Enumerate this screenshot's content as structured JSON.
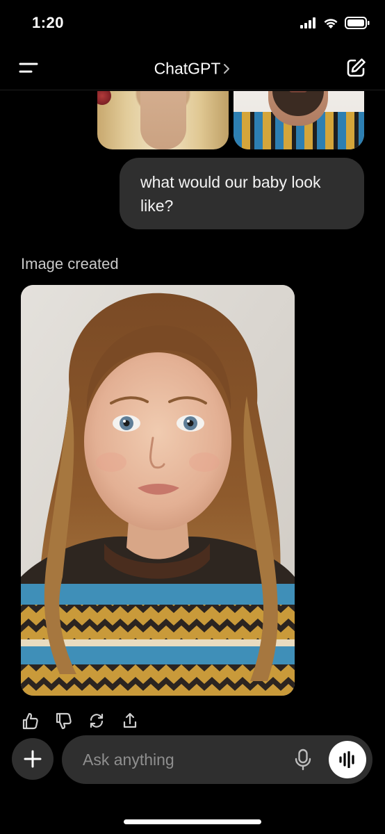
{
  "status_bar": {
    "time": "1:20",
    "icons": [
      "cellular-signal-icon",
      "wifi-icon",
      "battery-icon"
    ]
  },
  "nav": {
    "title": "ChatGPT",
    "icons": [
      "menu-icon",
      "chevron-right-icon",
      "new-chat-icon"
    ]
  },
  "chat": {
    "user_images": [
      "woman-portrait-photo",
      "man-portrait-photo"
    ],
    "user_message": "what would our baby look like?",
    "assistant_label": "Image created",
    "generated_image": "toddler-portrait-image",
    "actions": [
      "thumbs-up-icon",
      "thumbs-down-icon",
      "regenerate-icon",
      "share-icon"
    ]
  },
  "composer": {
    "placeholder": "Ask anything",
    "icons": [
      "plus-icon",
      "microphone-icon",
      "voice-mode-icon"
    ]
  },
  "colors": {
    "background": "#000000",
    "bubble": "#2f2f2f",
    "text": "#ffffff",
    "muted_text": "#c9c9c9",
    "placeholder": "#8f8f8f"
  }
}
